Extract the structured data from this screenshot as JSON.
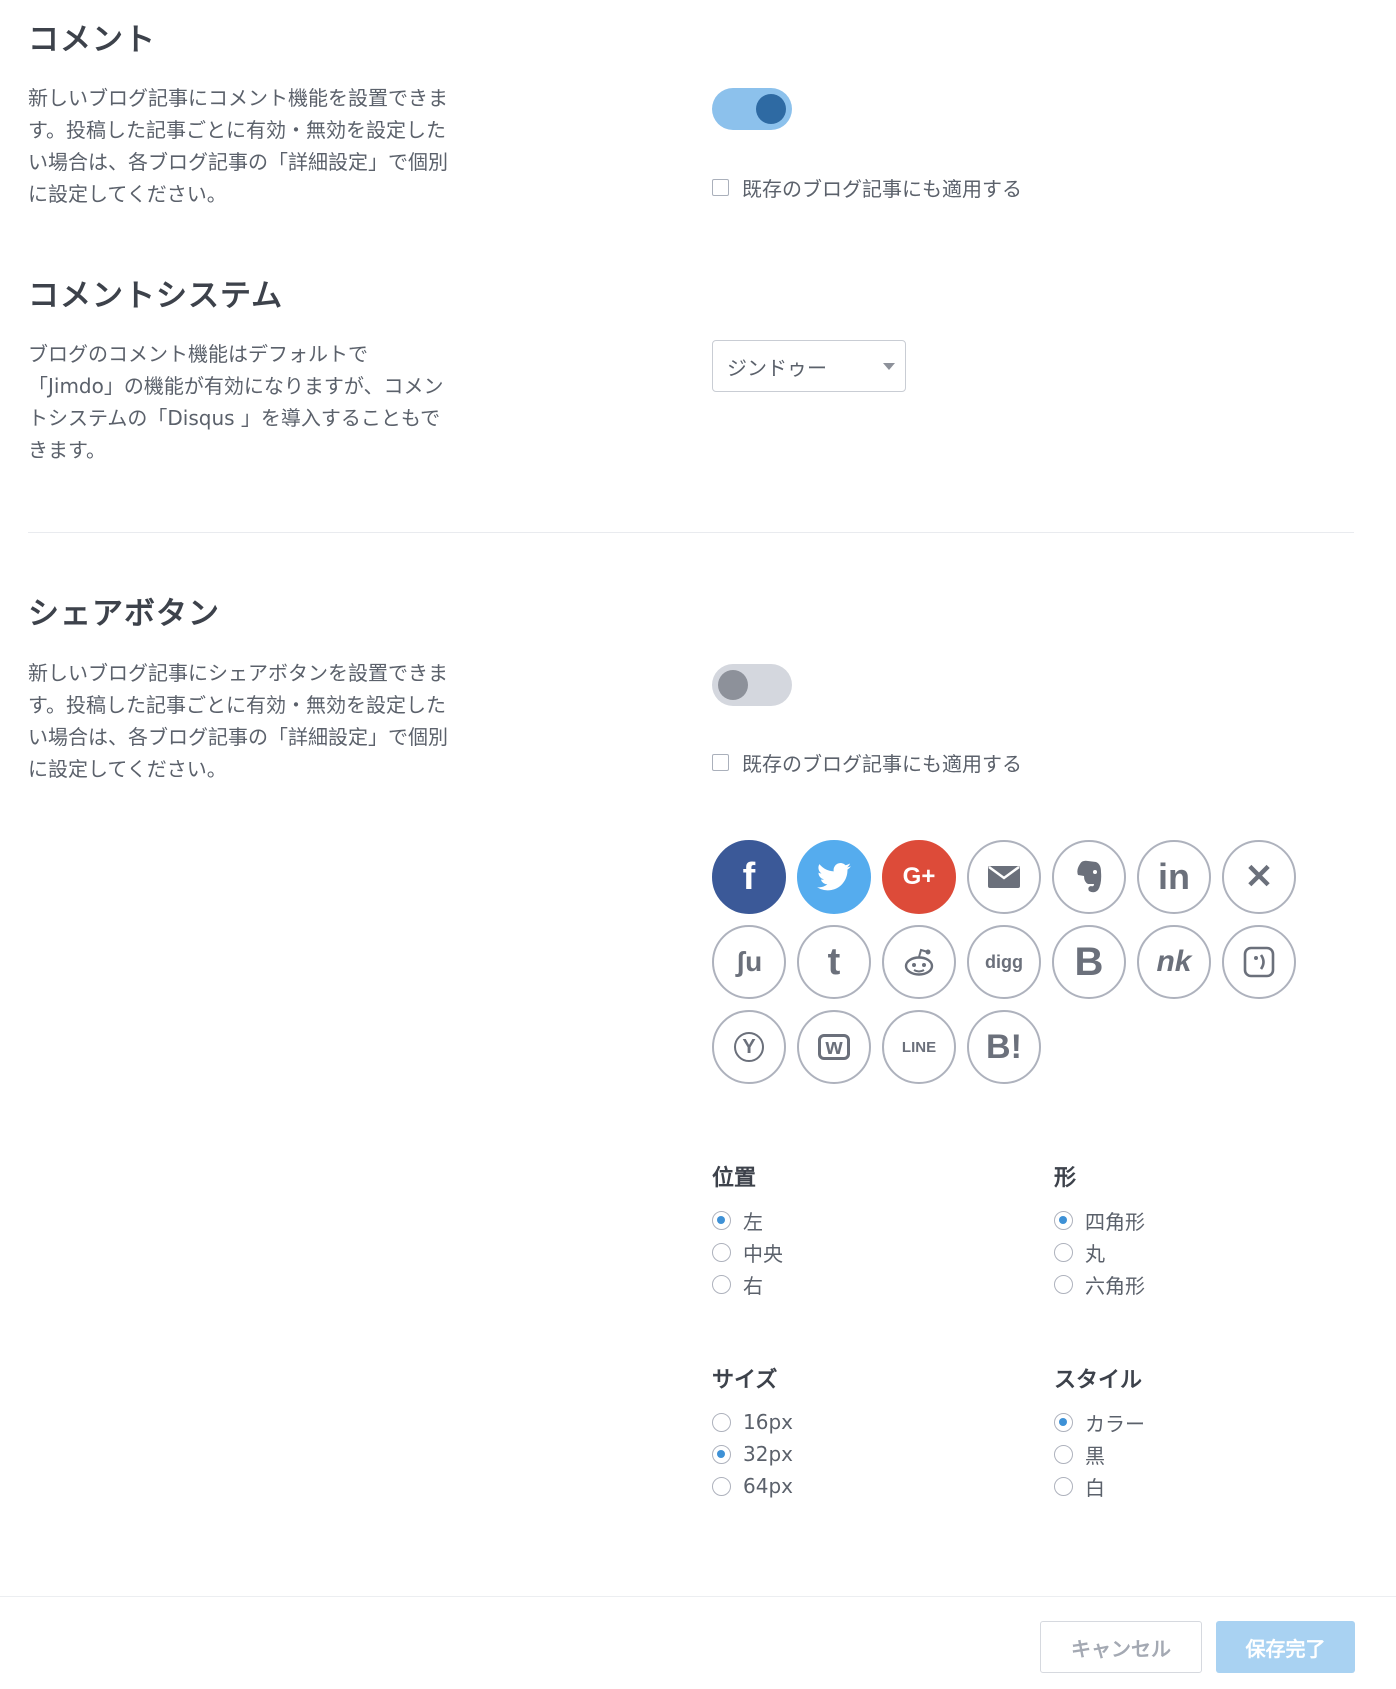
{
  "comment": {
    "title": "コメント",
    "description": "新しいブログ記事にコメント機能を設置できます。投稿した記事ごとに有効・無効を設定したい場合は、各ブログ記事の「詳細設定」で個別に設定してください。",
    "toggle_on": true,
    "apply_existing_label": "既存のブログ記事にも適用する"
  },
  "comment_system": {
    "title": "コメントシステム",
    "description": "ブログのコメント機能はデフォルトで「Jimdo」の機能が有効になりますが、コメントシステムの「Disqus 」を導入することもできます。",
    "selected": "ジンドゥー"
  },
  "share": {
    "title": "シェアボタン",
    "description": "新しいブログ記事にシェアボタンを設置できます。投稿した記事ごとに有効・無効を設定したい場合は、各ブログ記事の「詳細設定」で個別に設定してください。",
    "toggle_on": false,
    "apply_existing_label": "既存のブログ記事にも適用する",
    "icons": [
      {
        "name": "facebook-icon",
        "glyph": "f"
      },
      {
        "name": "twitter-icon",
        "glyph": ""
      },
      {
        "name": "google-plus-icon",
        "glyph": "G+"
      },
      {
        "name": "email-icon",
        "glyph": ""
      },
      {
        "name": "evernote-icon",
        "glyph": ""
      },
      {
        "name": "linkedin-icon",
        "glyph": "in"
      },
      {
        "name": "xing-icon",
        "glyph": "✕"
      },
      {
        "name": "stumbleupon-icon",
        "glyph": "ʃu"
      },
      {
        "name": "tumblr-icon",
        "glyph": "t"
      },
      {
        "name": "reddit-icon",
        "glyph": ""
      },
      {
        "name": "digg-icon",
        "glyph": "digg"
      },
      {
        "name": "vk-icon",
        "glyph": "B"
      },
      {
        "name": "nk-icon",
        "glyph": "nk"
      },
      {
        "name": "tuenti-icon",
        "glyph": ""
      },
      {
        "name": "yahoo-icon",
        "glyph": "Y"
      },
      {
        "name": "wykop-icon",
        "glyph": "w"
      },
      {
        "name": "line-icon",
        "glyph": "LINE"
      },
      {
        "name": "hatena-icon",
        "glyph": "B!"
      }
    ],
    "position": {
      "title": "位置",
      "options": [
        "左",
        "中央",
        "右"
      ],
      "selected": "左"
    },
    "shape": {
      "title": "形",
      "options": [
        "四角形",
        "丸",
        "六角形"
      ],
      "selected": "四角形"
    },
    "size": {
      "title": "サイズ",
      "options": [
        "16px",
        "32px",
        "64px"
      ],
      "selected": "32px"
    },
    "style": {
      "title": "スタイル",
      "options": [
        "カラー",
        "黒",
        "白"
      ],
      "selected": "カラー"
    }
  },
  "footer": {
    "cancel_label": "キャンセル",
    "save_label": "保存完了"
  }
}
